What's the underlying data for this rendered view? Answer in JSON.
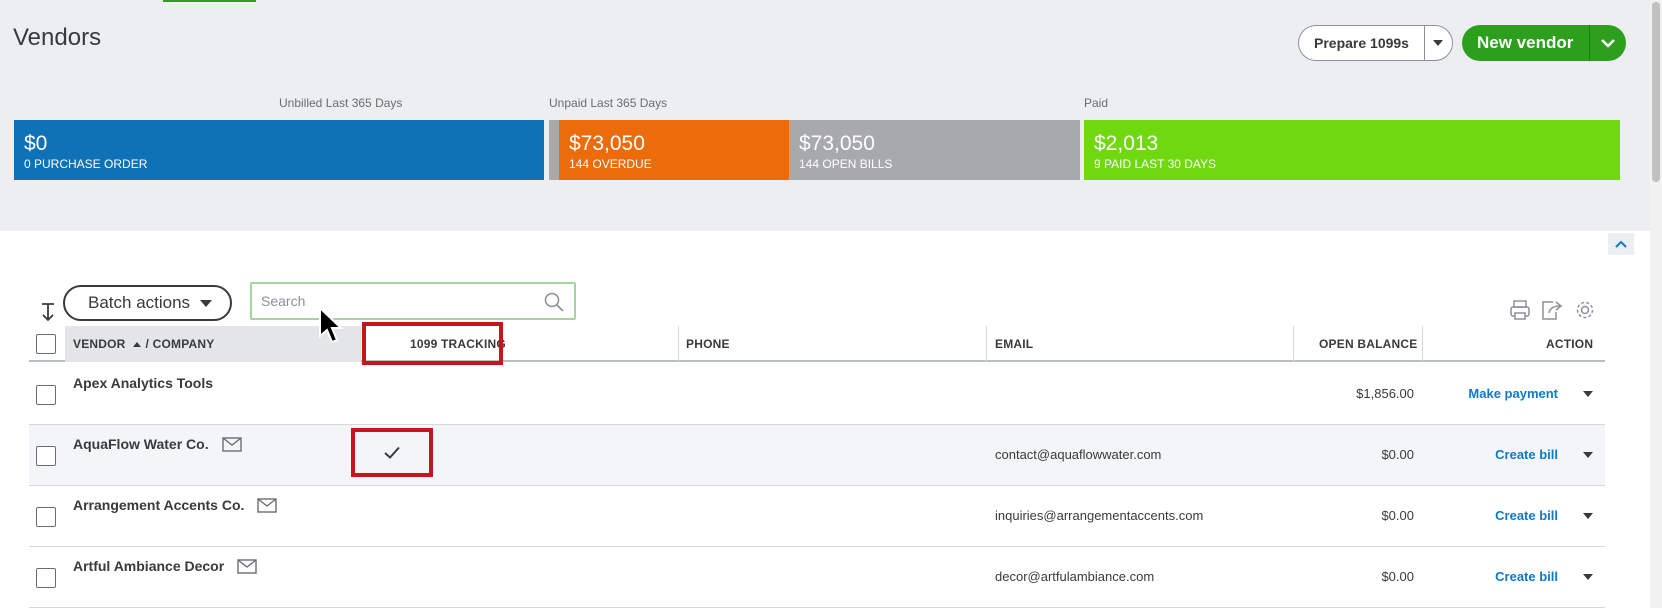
{
  "header": {
    "title": "Vendors",
    "prepare_label": "Prepare 1099s",
    "new_vendor_label": "New vendor"
  },
  "money_bar": {
    "unbilled_label": "Unbilled Last 365 Days",
    "unpaid_label": "Unpaid Last 365 Days",
    "paid_label": "Paid",
    "purchase_order": {
      "amount": "$0",
      "sub": "0 PURCHASE ORDER",
      "color": "#0f71b6"
    },
    "overdue": {
      "amount": "$73,050",
      "sub": "144 OVERDUE",
      "color": "#ec6b0a"
    },
    "open_bills": {
      "amount": "$73,050",
      "sub": "144 OPEN BILLS",
      "color": "#a8a9ad"
    },
    "paid": {
      "amount": "$2,013",
      "sub": "9 PAID LAST 30 DAYS",
      "color": "#6fd80f"
    }
  },
  "toolbar": {
    "batch_label": "Batch actions",
    "search_placeholder": "Search"
  },
  "table": {
    "headers": {
      "vendor": "VENDOR",
      "company": "/ COMPANY",
      "tracking": "1099 TRACKING",
      "phone": "PHONE",
      "email": "EMAIL",
      "balance": "OPEN BALANCE",
      "action": "ACTION"
    },
    "rows": [
      {
        "name": "Apex Analytics Tools",
        "email": "",
        "balance": "$1,856.00",
        "action": "Make payment"
      },
      {
        "name": "AquaFlow Water Co.",
        "email": "contact@aquaflowwater.com",
        "balance": "$0.00",
        "action": "Create bill"
      },
      {
        "name": "Arrangement Accents Co.",
        "email": "inquiries@arrangementaccents.com",
        "balance": "$0.00",
        "action": "Create bill"
      },
      {
        "name": "Artful Ambiance Decor",
        "email": "decor@artfulambiance.com",
        "balance": "$0.00",
        "action": "Create bill"
      }
    ]
  },
  "icons": {
    "print": "printer-icon",
    "export": "export-icon",
    "settings": "gear-icon",
    "mail": "envelope-icon",
    "check": "checkmark-icon"
  },
  "colors": {
    "primary_green": "#2ca01c",
    "link_blue": "#0d7ac9",
    "highlight_red": "#c4161c"
  }
}
